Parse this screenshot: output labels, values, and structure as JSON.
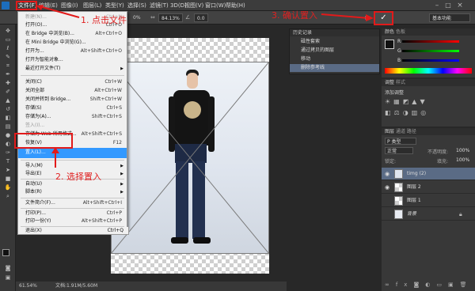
{
  "menubar": {
    "items": [
      "文件(F)",
      "编辑(E)",
      "图像(I)",
      "图层(L)",
      "类型(Y)",
      "选择(S)",
      "滤镜(T)",
      "3D(D)",
      "视图(V)",
      "窗口(W)",
      "帮助(H)"
    ]
  },
  "options": {
    "zoom": "84.13%",
    "angle_label": "0.0",
    "pct": "0%",
    "right_label": "基本功能"
  },
  "file_menu": {
    "items": [
      {
        "label": "新建(N)...",
        "shortcut": "Ctrl+N",
        "state": "dis"
      },
      {
        "label": "打开(O)...",
        "shortcut": "Ctrl+O"
      },
      {
        "label": "在 Bridge 中浏览(B)...",
        "shortcut": "Alt+Ctrl+O"
      },
      {
        "label": "在 Mini Bridge 中浏览(G)...",
        "shortcut": ""
      },
      {
        "label": "打开为...",
        "shortcut": "Alt+Shift+Ctrl+O"
      },
      {
        "label": "打开为智能对象...",
        "shortcut": ""
      },
      {
        "label": "最近打开文件(T)",
        "shortcut": "",
        "sub": true
      },
      {
        "label": "关闭(C)",
        "shortcut": "Ctrl+W"
      },
      {
        "label": "关闭全部",
        "shortcut": "Alt+Ctrl+W"
      },
      {
        "label": "关闭并转到 Bridge...",
        "shortcut": "Shift+Ctrl+W"
      },
      {
        "label": "存储(S)",
        "shortcut": "Ctrl+S"
      },
      {
        "label": "存储为(A)...",
        "shortcut": "Shift+Ctrl+S"
      },
      {
        "label": "签入(I)...",
        "shortcut": "",
        "state": "dis"
      },
      {
        "label": "存储为 Web 所用格式...",
        "shortcut": "Alt+Shift+Ctrl+S"
      },
      {
        "label": "恢复(V)",
        "shortcut": "F12"
      },
      {
        "label": "置入(L)...",
        "shortcut": "",
        "state": "hl"
      },
      {
        "label": "导入(M)",
        "shortcut": "",
        "sub": true
      },
      {
        "label": "导出(E)",
        "shortcut": "",
        "sub": true
      },
      {
        "label": "自动(U)",
        "shortcut": "",
        "sub": true
      },
      {
        "label": "脚本(R)",
        "shortcut": "",
        "sub": true
      },
      {
        "label": "文件简介(F)...",
        "shortcut": "Alt+Shift+Ctrl+I"
      },
      {
        "label": "打印(P)...",
        "shortcut": "Ctrl+P"
      },
      {
        "label": "打印一份(Y)",
        "shortcut": "Alt+Shift+Ctrl+P"
      },
      {
        "label": "退出(X)",
        "shortcut": "Ctrl+Q"
      }
    ]
  },
  "annotations": {
    "step1": "1. 点击文件",
    "step2": "2. 选择置入",
    "step3": "3. 确认置入"
  },
  "history": {
    "title": "历史记录",
    "items": [
      "磁性套索",
      "通过拷贝的图层",
      "移动",
      "删除参考线"
    ]
  },
  "color_panel": {
    "tabs": [
      "颜色",
      "色板"
    ],
    "channels": [
      "R",
      "G",
      "B"
    ]
  },
  "adjust_panel": {
    "tabs": [
      "调整",
      "样式"
    ],
    "title": "添加调整"
  },
  "layers_panel": {
    "tabs": [
      "图层",
      "通道",
      "路径"
    ],
    "search_label": "P 类型",
    "blend": "正常",
    "opacity_label": "不透明度:",
    "opacity": "100%",
    "lock_label": "锁定:",
    "fill_label": "填充:",
    "fill": "100%",
    "layers": [
      {
        "name": "timg (2)",
        "selected": true
      },
      {
        "name": "图层 2"
      },
      {
        "name": "图层 1"
      },
      {
        "name": "背景",
        "locked": true
      }
    ]
  },
  "status": {
    "zoom": "61.54%",
    "doc": "文档:1.91M/5.60M"
  },
  "colors": {
    "annotation": "#e02020",
    "highlight": "#3399ff"
  }
}
